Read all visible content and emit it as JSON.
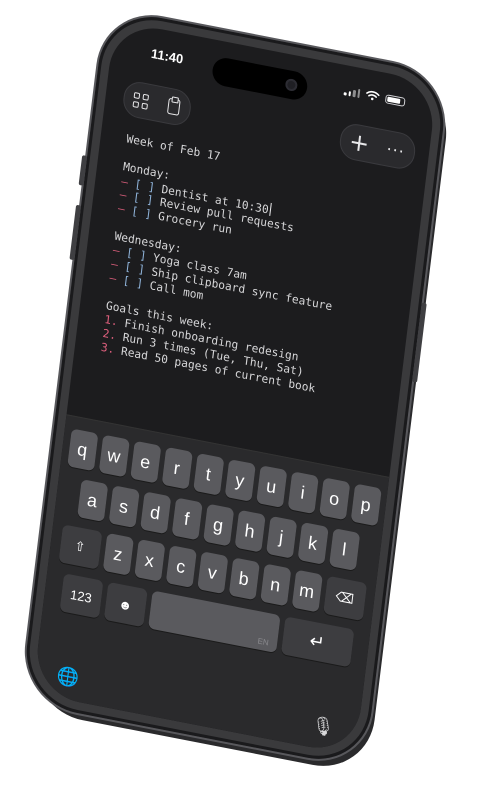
{
  "status_bar": {
    "time": "11:40"
  },
  "toolbar": {
    "plus_label": "+",
    "more_label": "···"
  },
  "editor": {
    "lines": [
      {
        "kind": "text",
        "text": "Week of Feb 17"
      },
      {
        "kind": "gap"
      },
      {
        "kind": "text",
        "text": "Monday:"
      },
      {
        "kind": "todo",
        "marker": "–",
        "box": "[ ]",
        "text": "Dentist at 10:30",
        "cursor": true
      },
      {
        "kind": "todo",
        "marker": "–",
        "box": "[ ]",
        "text": "Review pull requests"
      },
      {
        "kind": "todo",
        "marker": "–",
        "box": "[ ]",
        "text": "Grocery run"
      },
      {
        "kind": "gap"
      },
      {
        "kind": "text",
        "text": "Wednesday:"
      },
      {
        "kind": "todo",
        "marker": "–",
        "box": "[ ]",
        "text": "Yoga class 7am"
      },
      {
        "kind": "todo",
        "marker": "–",
        "box": "[ ]",
        "text": "Ship clipboard sync feature"
      },
      {
        "kind": "todo",
        "marker": "–",
        "box": "[ ]",
        "text": "Call mom"
      },
      {
        "kind": "gap"
      },
      {
        "kind": "text",
        "text": "Goals this week:"
      },
      {
        "kind": "num",
        "marker": "1.",
        "text": "Finish onboarding redesign"
      },
      {
        "kind": "num",
        "marker": "2.",
        "text": "Run 3 times (Tue, Thu, Sat)"
      },
      {
        "kind": "num",
        "marker": "3.",
        "text": "Read 50 pages of current book"
      }
    ]
  },
  "keyboard": {
    "row1": [
      "q",
      "w",
      "e",
      "r",
      "t",
      "y",
      "u",
      "i",
      "o",
      "p"
    ],
    "row2": [
      "a",
      "s",
      "d",
      "f",
      "g",
      "h",
      "j",
      "k",
      "l"
    ],
    "row3": [
      "z",
      "x",
      "c",
      "v",
      "b",
      "n",
      "m"
    ],
    "numbers_label": "123",
    "emoji_label": "☻",
    "shift_label": "⇧",
    "delete_label": "⌫",
    "return_label": "↵",
    "globe_label": "🌐",
    "mic_label": "🎙",
    "space_lang": "EN"
  },
  "colors": {
    "accent_marker": "#e0607e",
    "checkbox": "#8fb3d9",
    "screen_bg": "#1c1c1e",
    "keyboard_bg": "#2a2a2c"
  }
}
